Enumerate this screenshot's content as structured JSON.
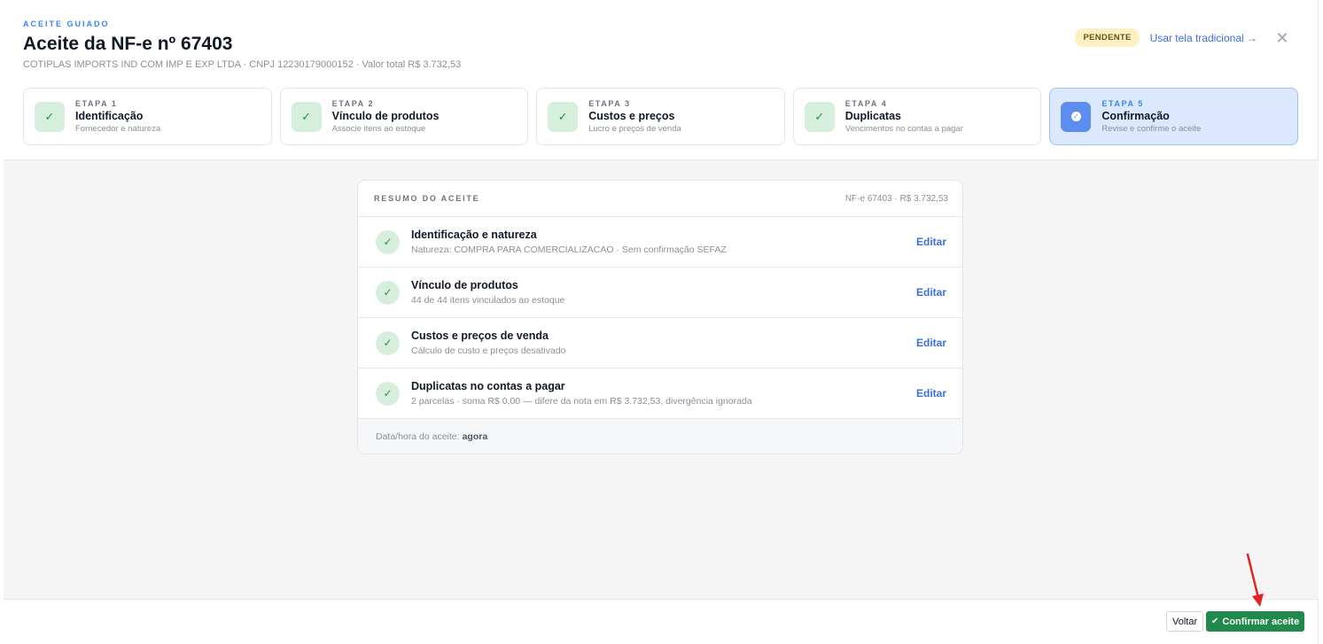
{
  "header": {
    "eyebrow": "ACEITE GUIADO",
    "title": "Aceite da NF-e nº 67403",
    "subtitle": "COTIPLAS IMPORTS IND COM IMP E EXP LTDA · CNPJ 12230179000152 · Valor total R$ 3.732,53",
    "badge": "PENDENTE",
    "traditional_link": "Usar tela tradicional →",
    "close_glyph": "✕"
  },
  "steps": [
    {
      "label": "ETAPA 1",
      "name": "Identificação",
      "desc": "Fornecedor e natureza",
      "status": "done"
    },
    {
      "label": "ETAPA 2",
      "name": "Vínculo de produtos",
      "desc": "Associe itens ao estoque",
      "status": "done"
    },
    {
      "label": "ETAPA 3",
      "name": "Custos e preços",
      "desc": "Lucro e preços de venda",
      "status": "done"
    },
    {
      "label": "ETAPA 4",
      "name": "Duplicatas",
      "desc": "Vencimentos no contas a pagar",
      "status": "done"
    },
    {
      "label": "ETAPA 5",
      "name": "Confirmação",
      "desc": "Revise e confirme o aceite",
      "status": "active"
    }
  ],
  "summary": {
    "title": "RESUMO DO ACEITE",
    "meta": "NF-e 67403 · R$ 3.732,53",
    "rows": [
      {
        "title": "Identificação e natureza",
        "desc": "Natureza: COMPRA PARA COMERCIALIZACAO · Sem confirmação SEFAZ",
        "action": "Editar"
      },
      {
        "title": "Vínculo de produtos",
        "desc": "44 de 44 itens vinculados ao estoque",
        "action": "Editar"
      },
      {
        "title": "Custos e preços de venda",
        "desc": "Cálculo de custo e preços desativado",
        "action": "Editar"
      },
      {
        "title": "Duplicatas no contas a pagar",
        "desc": "2 parcelas · soma R$ 0,00 — difere da nota em R$ 3.732,53, divergência ignorada",
        "action": "Editar"
      }
    ],
    "footer_label": "Data/hora do aceite:",
    "footer_value": "agora"
  },
  "footer": {
    "back_label": "Voltar",
    "confirm_label": "Confirmar aceite"
  },
  "colors": {
    "accent": "#3b82f6",
    "success": "#1f8a4c",
    "badge_bg": "#fdf1c4",
    "annotation_arrow": "#e02424"
  },
  "icons": {
    "step_done": "check-icon",
    "step_active": "check-circle-icon",
    "row_done": "check-icon",
    "confirm": "double-check-icon",
    "close": "close-icon"
  }
}
